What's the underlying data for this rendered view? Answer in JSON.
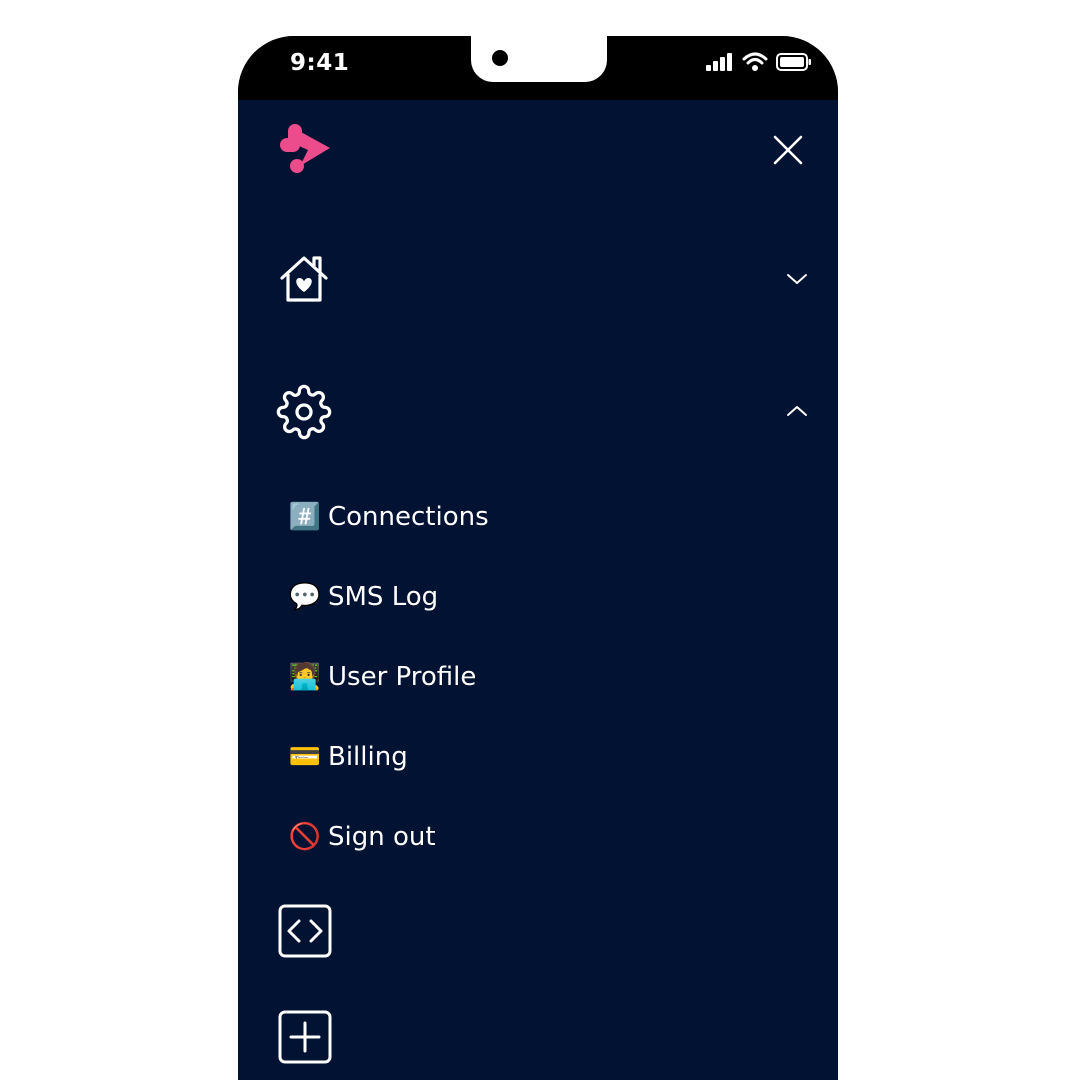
{
  "status_bar": {
    "time": "9:41"
  },
  "header": {
    "logo": "brand-logo",
    "close_icon": "close-icon"
  },
  "nav": {
    "home": {
      "icon": "home-heart-icon",
      "chevron": "chevron-down-icon"
    },
    "settings": {
      "icon": "gear-icon",
      "chevron": "chevron-up-icon"
    },
    "settings_items": [
      {
        "emoji": "#️⃣",
        "label": "Connections"
      },
      {
        "emoji": "💬",
        "label": "SMS Log"
      },
      {
        "emoji": "🧑‍💻",
        "label": "User Profile"
      },
      {
        "emoji": "💳",
        "label": "Billing"
      },
      {
        "emoji": "🚫",
        "label": "Sign out"
      }
    ],
    "code": {
      "icon": "code-icon"
    },
    "add": {
      "icon": "plus-square-icon"
    }
  },
  "colors": {
    "background": "#011233",
    "status_bar": "#000000",
    "brand": "#EC4B8C",
    "text": "#FFFFFF"
  }
}
